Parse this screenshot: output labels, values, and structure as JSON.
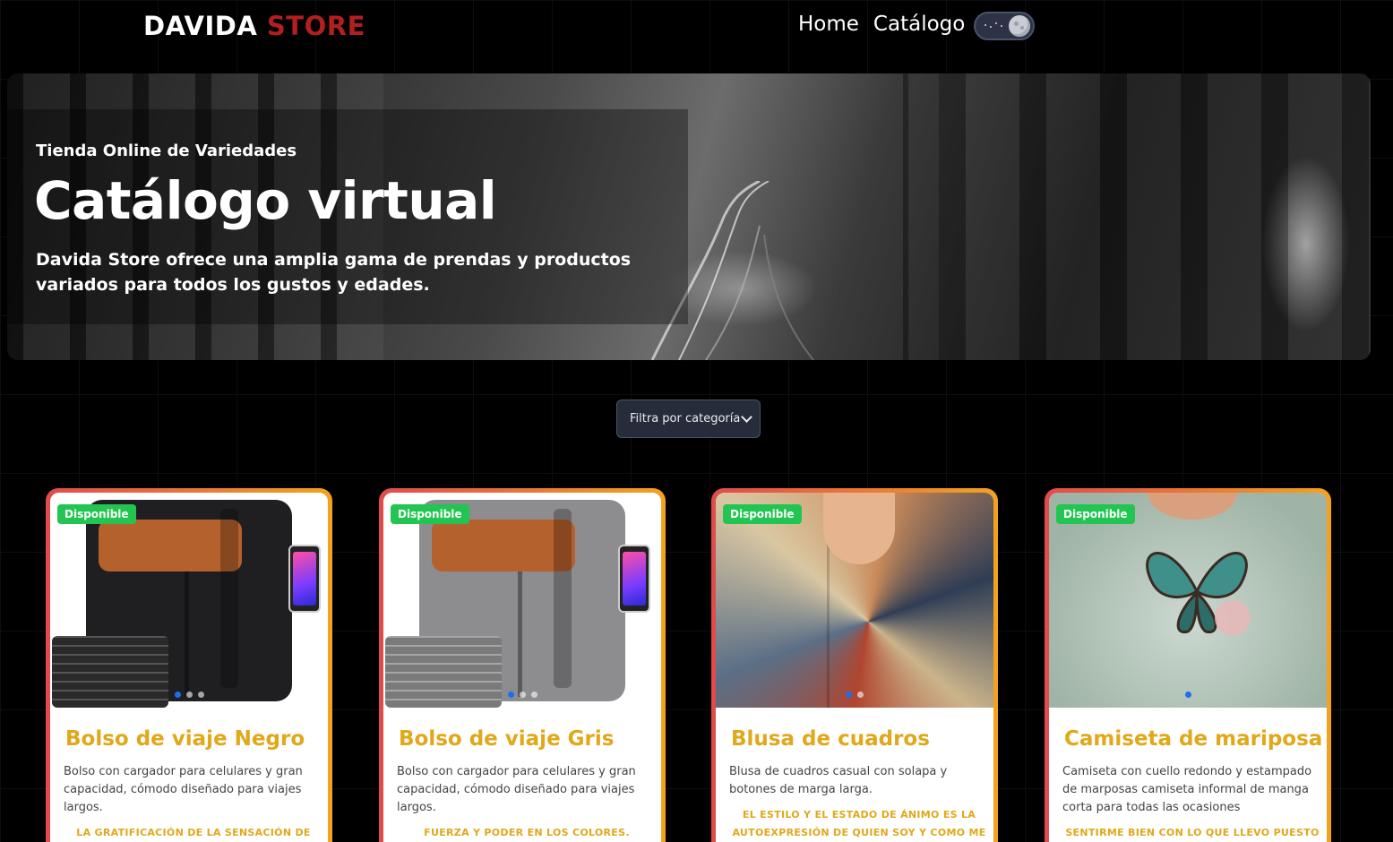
{
  "brand": {
    "part1": "DAVIDA",
    "part2": "STORE"
  },
  "nav": {
    "home": "Home",
    "catalog": "Catálogo"
  },
  "hero": {
    "kicker": "Tienda Online de Variedades",
    "title": "Catálogo virtual",
    "description": "Davida Store ofrece una amplia gama de prendas y productos variados para todos los gustos y edades."
  },
  "filter": {
    "selected": "Filtra por categoría"
  },
  "colors": {
    "brand_red": "#b11f1f",
    "accent_gold": "#e0a81a",
    "badge_green": "#23c552"
  },
  "products": [
    {
      "badge": "Disponible",
      "title": "Bolso de viaje Negro",
      "description": "Bolso con cargador para celulares y gran capacidad, cómodo diseñado para viajes largos.",
      "tagline": "LA GRATIFICACIÓN DE LA SENSACIÓN DE"
    },
    {
      "badge": "Disponible",
      "title": "Bolso de viaje Gris",
      "description": "Bolso con cargador para celulares y gran capacidad, cómodo diseñado para viajes largos.",
      "tagline": "FUERZA Y PODER EN LOS COLORES."
    },
    {
      "badge": "Disponible",
      "title": "Blusa de cuadros",
      "description": "Blusa de cuadros casual con solapa y botones de marga larga.",
      "tagline": "EL ESTILO Y EL ESTADO DE ÁNIMO ES LA AUTOEXPRESIÓN DE QUIEN SOY Y COMO ME"
    },
    {
      "badge": "Disponible",
      "title": "Camiseta de mariposa",
      "description": "Camiseta con cuello redondo y estampado de marposas camiseta informal de manga corta para todas las ocasiones",
      "tagline": "SENTIRME BIEN CON LO QUE LLEVO PUESTO"
    }
  ]
}
